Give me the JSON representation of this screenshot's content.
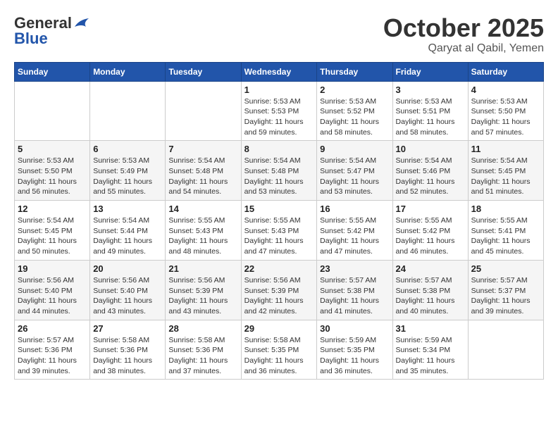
{
  "header": {
    "logo_line1": "General",
    "logo_line2": "Blue",
    "month": "October 2025",
    "location": "Qaryat al Qabil, Yemen"
  },
  "days_of_week": [
    "Sunday",
    "Monday",
    "Tuesday",
    "Wednesday",
    "Thursday",
    "Friday",
    "Saturday"
  ],
  "weeks": [
    [
      {
        "day": "",
        "info": ""
      },
      {
        "day": "",
        "info": ""
      },
      {
        "day": "",
        "info": ""
      },
      {
        "day": "1",
        "info": "Sunrise: 5:53 AM\nSunset: 5:53 PM\nDaylight: 11 hours\nand 59 minutes."
      },
      {
        "day": "2",
        "info": "Sunrise: 5:53 AM\nSunset: 5:52 PM\nDaylight: 11 hours\nand 58 minutes."
      },
      {
        "day": "3",
        "info": "Sunrise: 5:53 AM\nSunset: 5:51 PM\nDaylight: 11 hours\nand 58 minutes."
      },
      {
        "day": "4",
        "info": "Sunrise: 5:53 AM\nSunset: 5:50 PM\nDaylight: 11 hours\nand 57 minutes."
      }
    ],
    [
      {
        "day": "5",
        "info": "Sunrise: 5:53 AM\nSunset: 5:50 PM\nDaylight: 11 hours\nand 56 minutes."
      },
      {
        "day": "6",
        "info": "Sunrise: 5:53 AM\nSunset: 5:49 PM\nDaylight: 11 hours\nand 55 minutes."
      },
      {
        "day": "7",
        "info": "Sunrise: 5:54 AM\nSunset: 5:48 PM\nDaylight: 11 hours\nand 54 minutes."
      },
      {
        "day": "8",
        "info": "Sunrise: 5:54 AM\nSunset: 5:48 PM\nDaylight: 11 hours\nand 53 minutes."
      },
      {
        "day": "9",
        "info": "Sunrise: 5:54 AM\nSunset: 5:47 PM\nDaylight: 11 hours\nand 53 minutes."
      },
      {
        "day": "10",
        "info": "Sunrise: 5:54 AM\nSunset: 5:46 PM\nDaylight: 11 hours\nand 52 minutes."
      },
      {
        "day": "11",
        "info": "Sunrise: 5:54 AM\nSunset: 5:45 PM\nDaylight: 11 hours\nand 51 minutes."
      }
    ],
    [
      {
        "day": "12",
        "info": "Sunrise: 5:54 AM\nSunset: 5:45 PM\nDaylight: 11 hours\nand 50 minutes."
      },
      {
        "day": "13",
        "info": "Sunrise: 5:54 AM\nSunset: 5:44 PM\nDaylight: 11 hours\nand 49 minutes."
      },
      {
        "day": "14",
        "info": "Sunrise: 5:55 AM\nSunset: 5:43 PM\nDaylight: 11 hours\nand 48 minutes."
      },
      {
        "day": "15",
        "info": "Sunrise: 5:55 AM\nSunset: 5:43 PM\nDaylight: 11 hours\nand 47 minutes."
      },
      {
        "day": "16",
        "info": "Sunrise: 5:55 AM\nSunset: 5:42 PM\nDaylight: 11 hours\nand 47 minutes."
      },
      {
        "day": "17",
        "info": "Sunrise: 5:55 AM\nSunset: 5:42 PM\nDaylight: 11 hours\nand 46 minutes."
      },
      {
        "day": "18",
        "info": "Sunrise: 5:55 AM\nSunset: 5:41 PM\nDaylight: 11 hours\nand 45 minutes."
      }
    ],
    [
      {
        "day": "19",
        "info": "Sunrise: 5:56 AM\nSunset: 5:40 PM\nDaylight: 11 hours\nand 44 minutes."
      },
      {
        "day": "20",
        "info": "Sunrise: 5:56 AM\nSunset: 5:40 PM\nDaylight: 11 hours\nand 43 minutes."
      },
      {
        "day": "21",
        "info": "Sunrise: 5:56 AM\nSunset: 5:39 PM\nDaylight: 11 hours\nand 43 minutes."
      },
      {
        "day": "22",
        "info": "Sunrise: 5:56 AM\nSunset: 5:39 PM\nDaylight: 11 hours\nand 42 minutes."
      },
      {
        "day": "23",
        "info": "Sunrise: 5:57 AM\nSunset: 5:38 PM\nDaylight: 11 hours\nand 41 minutes."
      },
      {
        "day": "24",
        "info": "Sunrise: 5:57 AM\nSunset: 5:38 PM\nDaylight: 11 hours\nand 40 minutes."
      },
      {
        "day": "25",
        "info": "Sunrise: 5:57 AM\nSunset: 5:37 PM\nDaylight: 11 hours\nand 39 minutes."
      }
    ],
    [
      {
        "day": "26",
        "info": "Sunrise: 5:57 AM\nSunset: 5:36 PM\nDaylight: 11 hours\nand 39 minutes."
      },
      {
        "day": "27",
        "info": "Sunrise: 5:58 AM\nSunset: 5:36 PM\nDaylight: 11 hours\nand 38 minutes."
      },
      {
        "day": "28",
        "info": "Sunrise: 5:58 AM\nSunset: 5:36 PM\nDaylight: 11 hours\nand 37 minutes."
      },
      {
        "day": "29",
        "info": "Sunrise: 5:58 AM\nSunset: 5:35 PM\nDaylight: 11 hours\nand 36 minutes."
      },
      {
        "day": "30",
        "info": "Sunrise: 5:59 AM\nSunset: 5:35 PM\nDaylight: 11 hours\nand 36 minutes."
      },
      {
        "day": "31",
        "info": "Sunrise: 5:59 AM\nSunset: 5:34 PM\nDaylight: 11 hours\nand 35 minutes."
      },
      {
        "day": "",
        "info": ""
      }
    ]
  ]
}
